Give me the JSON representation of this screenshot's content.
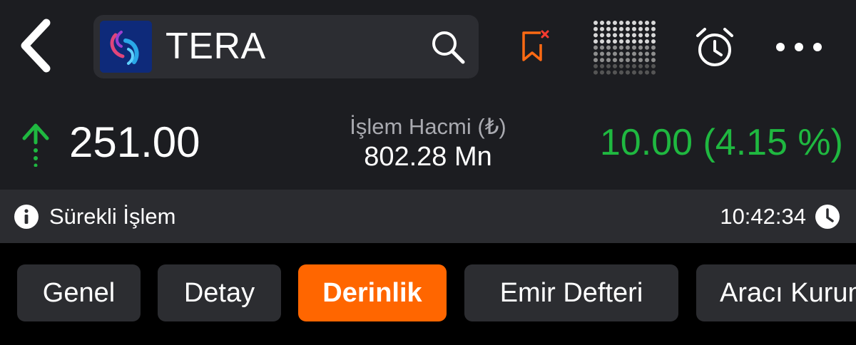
{
  "header": {
    "ticker": "TERA",
    "icons": {
      "back": "chevron-left-icon",
      "search": "search-icon",
      "bookmark": "bookmark-remove-icon",
      "grid": "dot-grid-icon",
      "alarm": "alarm-clock-icon",
      "more": "more-horizontal-icon"
    },
    "colors": {
      "background": "#1c1d21",
      "bookmark_accent": "#ff6a13"
    }
  },
  "price": {
    "direction": "up",
    "last": "251.00",
    "volume_label": "İşlem Hacmi (₺)",
    "volume_value": "802.28 Mn",
    "change": "10.00 (4.15 %)",
    "color_up": "#1fb840"
  },
  "status": {
    "text": "Sürekli İşlem",
    "time": "10:42:34"
  },
  "tabs": {
    "items": [
      {
        "label": "Genel"
      },
      {
        "label": "Detay"
      },
      {
        "label": "Derinlik"
      },
      {
        "label": "Emir Defteri"
      },
      {
        "label": "Aracı Kurum"
      }
    ],
    "active": "Derinlik",
    "active_color": "#ff6600"
  }
}
